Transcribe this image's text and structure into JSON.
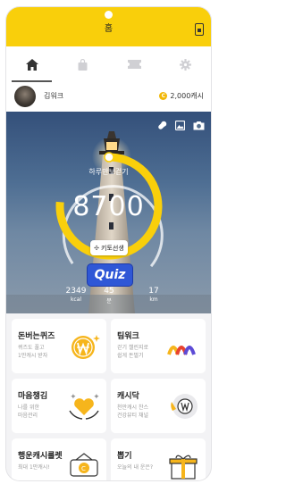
{
  "header": {
    "title": "홈"
  },
  "tabs": [
    {
      "icon": "home-icon",
      "active": true
    },
    {
      "icon": "shopping-bag-icon",
      "active": false
    },
    {
      "icon": "ticket-icon",
      "active": false
    },
    {
      "icon": "gear-icon",
      "active": false
    }
  ],
  "profile": {
    "name": "김워크",
    "cash": "2,000캐시",
    "coin_symbol": "C"
  },
  "hero": {
    "today_label": "하루만보걷기",
    "steps": "8700",
    "keto_label": "키토선생",
    "quiz_label": "Quiz",
    "stats": [
      {
        "value": "2349",
        "unit": "kcal"
      },
      {
        "value": "45",
        "unit": "분"
      },
      {
        "value": "17",
        "unit": "km"
      }
    ],
    "step_progress": 0.87
  },
  "cards": [
    {
      "title": "돈버는퀴즈",
      "line1": "퀴즈도 풀고",
      "line2": "1만캐시 받자",
      "icon": "won-coin-icon"
    },
    {
      "title": "팀워크",
      "line1": "걷기 챌린지로",
      "line2": "쉽게 돈벌기",
      "icon": "colorful-arches-icon"
    },
    {
      "title": "마음챙김",
      "line1": "나를 위한",
      "line2": "마음관리",
      "icon": "heart-hands-icon"
    },
    {
      "title": "캐시닥",
      "line1": "천만캐시 찬스",
      "line2": "건강뷰티 채널",
      "icon": "won-coin-plate-icon"
    },
    {
      "title": "행운캐시룰렛",
      "line1": "최대 1만캐시!",
      "line2": "",
      "icon": "roulette-coin-icon"
    },
    {
      "title": "뽑기",
      "line1": "오늘의 내 운은?",
      "line2": "",
      "icon": "gift-box-icon"
    }
  ],
  "colors": {
    "brand": "#f9cf0b",
    "quiz": "#2f57d6",
    "coin": "#f2b705"
  }
}
